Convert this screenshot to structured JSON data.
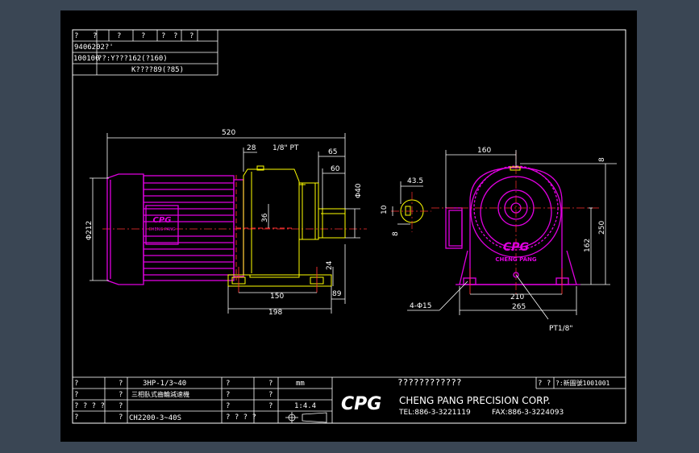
{
  "header_table": {
    "r1": [
      "?",
      "?",
      "?",
      "?",
      "?",
      "?",
      "?"
    ],
    "r2": [
      "9406202?'"
    ],
    "r3": [
      "100100",
      "??:Y???162(?160)"
    ],
    "r4": [
      "K????89(?85)"
    ]
  },
  "dimensions": {
    "d520": "520",
    "d28": "28",
    "d65": "65",
    "d60": "60",
    "d40": "Φ40",
    "d36": "36",
    "d212": "Φ212",
    "d24": "24",
    "d150": "150",
    "d198": "198",
    "d89": "89",
    "d43_5": "43.5",
    "d10": "10",
    "d8a": "8",
    "d160": "160",
    "d8b": "8",
    "d250": "250",
    "d162": "162",
    "d210": "210",
    "d265": "265",
    "holes": "4-Φ15"
  },
  "notes": {
    "vent": "1/8\" PT",
    "drain": "PT1/8\""
  },
  "logos": {
    "plate": "CPG",
    "plate_sub": "CHENG PANG",
    "title_logo": "CPG"
  },
  "title_block": {
    "a1": "?",
    "a2": "?",
    "a3": "3HP-1/3~40",
    "a4": "?",
    "a5": "?",
    "a6": "mm",
    "b1": "?",
    "b2": "?",
    "b3": "三相臥式齒輪減速機",
    "b4": "?",
    "b5": "?",
    "c1": "? ? ? ?",
    "c2": "?",
    "c4": "?",
    "c5": "?",
    "c6": "1:4.4",
    "d1": "?",
    "d2": "?",
    "d3": "CH2200-3~40S",
    "d4": "? ? ? ?",
    "company_cn": "????????????",
    "company_en": "CHENG PANG PRECISION CORP.",
    "tel": "TEL:886-3-3221119",
    "fax": "FAX:886-3-3224093",
    "doc_label": "? ?",
    "doc_no": "?:新圖號1001001"
  }
}
